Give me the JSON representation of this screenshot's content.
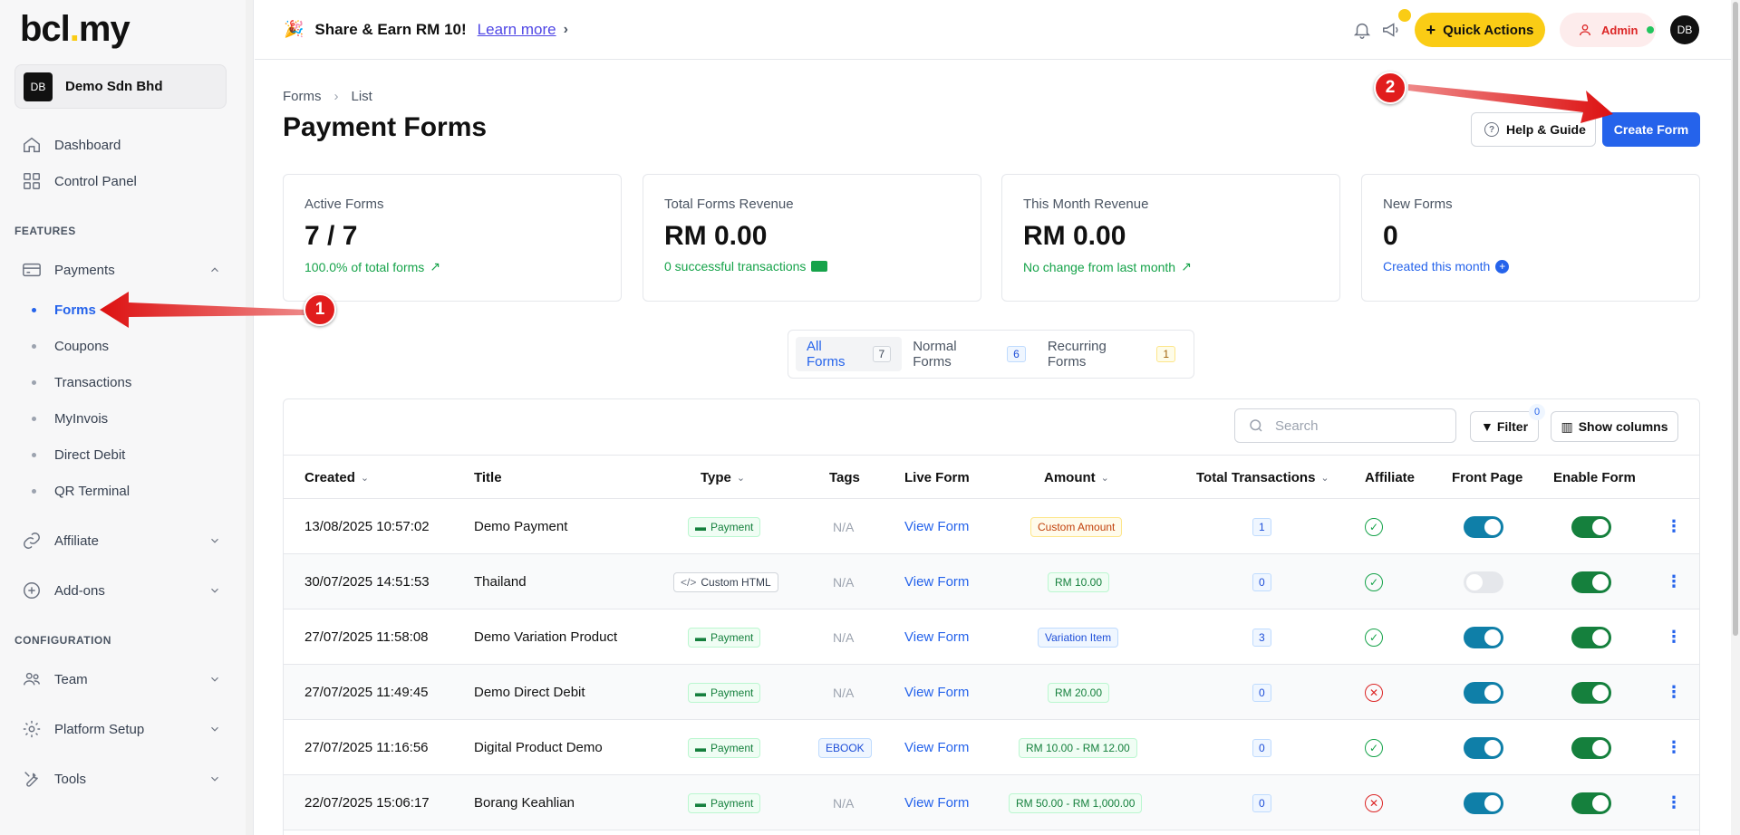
{
  "brand": {
    "logo_main": "bcl",
    "logo_dot": ".",
    "logo_tail": "my"
  },
  "org": {
    "avatar": "DB",
    "name": "Demo Sdn Bhd"
  },
  "sidebar": {
    "top_items": [
      {
        "label": "Dashboard"
      },
      {
        "label": "Control Panel"
      }
    ],
    "features_label": "FEATURES",
    "payments": {
      "label": "Payments"
    },
    "payments_sub": [
      "Forms",
      "Coupons",
      "Transactions",
      "MyInvois",
      "Direct Debit",
      "QR Terminal"
    ],
    "affiliate": {
      "label": "Affiliate"
    },
    "addons": {
      "label": "Add-ons"
    },
    "config_label": "CONFIGURATION",
    "team": {
      "label": "Team"
    },
    "platform": {
      "label": "Platform Setup"
    },
    "tools": {
      "label": "Tools"
    }
  },
  "topbar": {
    "promo_text": "Share & Earn RM 10!",
    "learn_more": "Learn more",
    "quick_actions": "Quick Actions",
    "admin": "Admin",
    "user_avatar": "DB"
  },
  "breadcrumb": {
    "parent": "Forms",
    "current": "List"
  },
  "page_title": "Payment Forms",
  "actions": {
    "help": "Help & Guide",
    "create": "Create Form"
  },
  "stats": [
    {
      "label": "Active Forms",
      "value": "7 / 7",
      "sub": "100.0% of total forms"
    },
    {
      "label": "Total Forms Revenue",
      "value": "RM 0.00",
      "sub": "0 successful transactions"
    },
    {
      "label": "This Month Revenue",
      "value": "RM 0.00",
      "sub": "No change from last month"
    },
    {
      "label": "New Forms",
      "value": "0",
      "sub": "Created this month"
    }
  ],
  "tabs": [
    {
      "label": "All Forms",
      "count": "7"
    },
    {
      "label": "Normal Forms",
      "count": "6"
    },
    {
      "label": "Recurring Forms",
      "count": "1"
    }
  ],
  "toolbar": {
    "search_placeholder": "Search",
    "filter": "Filter",
    "filter_count": "0",
    "show_columns": "Show columns"
  },
  "columns": [
    "Created",
    "Title",
    "Type",
    "Tags",
    "Live Form",
    "Amount",
    "Total Transactions",
    "Affiliate",
    "Front Page",
    "Enable Form"
  ],
  "rows": [
    {
      "created": "13/08/2025 10:57:02",
      "title": "Demo Payment",
      "type": "Payment",
      "tags": "N/A",
      "live": "View Form",
      "amount": "Custom Amount",
      "transactions": "1"
    },
    {
      "created": "30/07/2025 14:51:53",
      "title": "Thailand",
      "type": "Custom HTML",
      "tags": "N/A",
      "live": "View Form",
      "amount": "RM 10.00",
      "transactions": "0"
    },
    {
      "created": "27/07/2025 11:58:08",
      "title": "Demo Variation Product",
      "type": "Payment",
      "tags": "N/A",
      "live": "View Form",
      "amount": "Variation Item",
      "transactions": "3"
    },
    {
      "created": "27/07/2025 11:49:45",
      "title": "Demo Direct Debit",
      "type": "Payment",
      "tags": "N/A",
      "live": "View Form",
      "amount": "RM 20.00",
      "transactions": "0"
    },
    {
      "created": "27/07/2025 11:16:56",
      "title": "Digital Product Demo",
      "type": "Payment",
      "tags": "EBOOK",
      "live": "View Form",
      "amount": "RM 10.00 - RM 12.00",
      "transactions": "0"
    },
    {
      "created": "22/07/2025 15:06:17",
      "title": "Borang Keahlian",
      "type": "Payment",
      "tags": "N/A",
      "live": "View Form",
      "amount": "RM 50.00 - RM 1,000.00",
      "transactions": "0"
    }
  ],
  "annotations": [
    "1",
    "2"
  ],
  "colors": {
    "primary": "#2563eb",
    "accent": "#facc15",
    "success": "#16a34a",
    "danger": "#dc2626",
    "annotation": "#e11d1d"
  }
}
